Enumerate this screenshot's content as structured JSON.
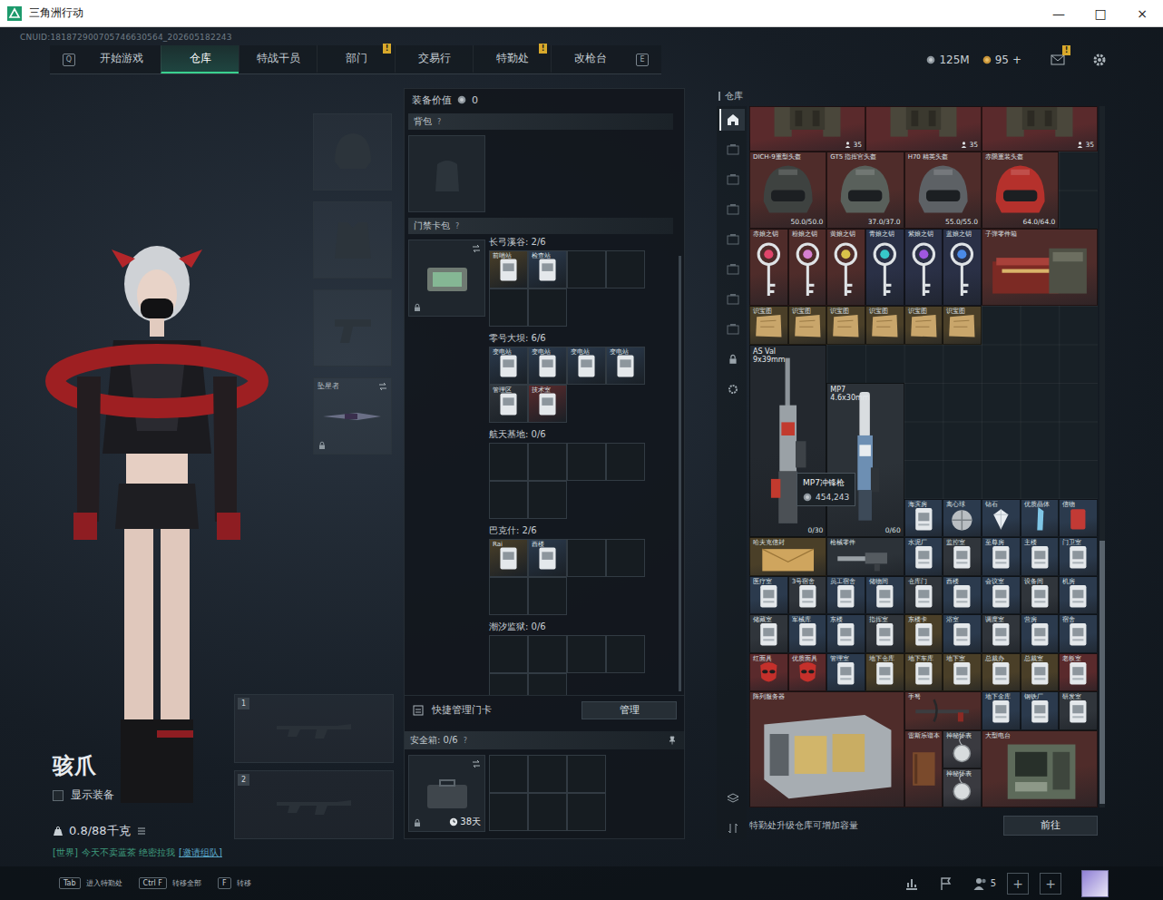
{
  "window": {
    "title": "三角洲行动",
    "controls": [
      "—",
      "□",
      "×"
    ]
  },
  "uid": "CNUID:181872900705746630564_202605182243",
  "nav": {
    "prev_key": "Q",
    "next_key": "E",
    "tabs": [
      {
        "label": "开始游戏",
        "selected": false
      },
      {
        "label": "仓库",
        "selected": true
      },
      {
        "label": "特战干员",
        "selected": false
      },
      {
        "label": "部门",
        "selected": false,
        "badge": "!"
      },
      {
        "label": "交易行",
        "selected": false
      },
      {
        "label": "特勤处",
        "selected": false,
        "badge": "!"
      },
      {
        "label": "改枪台",
        "selected": false
      }
    ],
    "currency": [
      {
        "kind": "coin",
        "value": "125M"
      },
      {
        "kind": "gold",
        "value": "95"
      }
    ],
    "add": "+",
    "mail_badge": "!"
  },
  "equipment_slots": [
    {
      "kind": "helmet",
      "locked": false
    },
    {
      "kind": "armor",
      "locked": false
    },
    {
      "kind": "pistol",
      "locked": false
    },
    {
      "kind": "melee",
      "label": "坠星者",
      "locked": true
    }
  ],
  "weapon_slots": [
    {
      "label": "1"
    },
    {
      "label": "2"
    }
  ],
  "character": {
    "name": "骇爪",
    "show_equipment": {
      "label": "显示装备",
      "checked": false
    },
    "weight": "0.8/88千克"
  },
  "chat": {
    "channel": "[世界]",
    "text": "今天不卖蓝茶 绝密拉我",
    "link": "[邀请组队]"
  },
  "loadout": {
    "value_label": "装备价值",
    "value": "0",
    "backpack": {
      "label": "背包",
      "help": "?"
    },
    "keycard_bag": {
      "label": "门禁卡包",
      "help": "?",
      "locked": true
    },
    "maps": [
      {
        "title": "长弓溪谷: 2/6",
        "cards": [
          {
            "name": "前哨站",
            "color": "#4a3f28"
          },
          {
            "name": "检查站",
            "color": "#2b3a4d"
          }
        ]
      },
      {
        "title": "零号大坝: 6/6",
        "cards": [
          {
            "name": "变电站",
            "color": "#2b3a4d"
          },
          {
            "name": "变电站",
            "color": "#2b3a4d"
          },
          {
            "name": "变电站",
            "color": "#2b3a4d"
          },
          {
            "name": "变电站",
            "color": "#2b3a4d"
          },
          {
            "name": "管理区",
            "color": "#30353b"
          },
          {
            "name": "技术室",
            "color": "#5a2a2c"
          }
        ]
      },
      {
        "title": "航天基地: 0/6",
        "cards": []
      },
      {
        "title": "巴克什: 2/6",
        "cards": [
          {
            "name": "Rai",
            "color": "#4a3f28"
          },
          {
            "name": "西楼",
            "color": "#2b3a4d"
          }
        ]
      },
      {
        "title": "潮汐监狱: 0/6",
        "cards": []
      }
    ],
    "quick_manage": {
      "label": "快捷管理门卡",
      "button": "管理"
    },
    "safe_box": {
      "label": "安全箱: 0/6",
      "help": "?",
      "days": "38天",
      "locked": true
    }
  },
  "warehouse": {
    "title": "仓库",
    "side_tabs": [
      {
        "kind": "home",
        "selected": true
      },
      {
        "kind": "box",
        "selected": false
      },
      {
        "kind": "box",
        "selected": false
      },
      {
        "kind": "box",
        "selected": false
      },
      {
        "kind": "box",
        "selected": false
      },
      {
        "kind": "box",
        "selected": false
      },
      {
        "kind": "box",
        "selected": false
      },
      {
        "kind": "box",
        "selected": false
      },
      {
        "kind": "lock",
        "selected": false
      },
      {
        "kind": "gear",
        "selected": false
      },
      {
        "kind": "layers",
        "selected": false
      },
      {
        "kind": "sort",
        "selected": false
      }
    ],
    "items": [
      {
        "kind": "armor",
        "badge": "35",
        "color": "#5a2a2c"
      },
      {
        "kind": "armor",
        "badge": "35",
        "color": "#5a2a2c"
      },
      {
        "kind": "armor",
        "badge": "35",
        "color": "#5a2a2c"
      },
      {
        "kind": "helmet",
        "name": "DICH-9重型头盔",
        "stat": "50.0/50.0",
        "color": "#4f2c2a",
        "tint": "#3e4240"
      },
      {
        "kind": "helmet",
        "name": "GT5 指挥官头盔",
        "stat": "37.0/37.0",
        "color": "#4f2c2a",
        "tint": "#59605b"
      },
      {
        "kind": "helmet",
        "name": "H70 精英头盔",
        "stat": "55.0/55.0",
        "color": "#4f2c2a",
        "tint": "#5d6165"
      },
      {
        "kind": "helmet",
        "name": "赤陨重装头盔",
        "stat": "64.0/64.0",
        "color": "#4f2c2a",
        "tint": "#b5312c"
      },
      {
        "kind": "key",
        "name": "赤娘之钥",
        "color": "#4f2c2a",
        "gem_color": "#e0456a"
      },
      {
        "kind": "key",
        "name": "粉娘之钥",
        "color": "#4f2c2a",
        "gem_color": "#d67fd0"
      },
      {
        "kind": "key",
        "name": "黄娘之钥",
        "color": "#4f2c2a",
        "gem_color": "#d9c24a"
      },
      {
        "kind": "key",
        "name": "青娘之钥",
        "color": "#2a3046",
        "gem_color": "#37c7c9"
      },
      {
        "kind": "key",
        "name": "紫娘之钥",
        "color": "#2a3046",
        "gem_color": "#a057e0"
      },
      {
        "kind": "key",
        "name": "蓝娘之钥",
        "color": "#2a3046",
        "gem_color": "#4a8ae6"
      },
      {
        "kind": "crate",
        "name": "子弹零件箱",
        "color": "#4f2c2a"
      },
      {
        "kind": "map",
        "name": "识宝图",
        "color": "#4a3f28"
      },
      {
        "kind": "map",
        "name": "识宝图",
        "color": "#4a3f28"
      },
      {
        "kind": "map",
        "name": "识宝图",
        "color": "#4a3f28"
      },
      {
        "kind": "map",
        "name": "识宝图",
        "color": "#4a3f28"
      },
      {
        "kind": "map",
        "name": "识宝图",
        "color": "#4a3f28"
      },
      {
        "kind": "map",
        "name": "识宝图",
        "color": "#4a3f28"
      },
      {
        "kind": "rifle",
        "name": "AS Val",
        "caliber": "9x39mm",
        "stat": "0/30",
        "color": "#23282e"
      },
      {
        "kind": "smg",
        "name": "MP7",
        "caliber": "4.6x30mm",
        "stat": "0/60",
        "color": "#2c3238"
      },
      {
        "kind": "card",
        "name": "海滨房",
        "color": "#2b3a4d"
      },
      {
        "kind": "ball",
        "name": "离心球",
        "color": "#2b3a4d"
      },
      {
        "kind": "diamond",
        "name": "钻石",
        "color": "#2b3a4d"
      },
      {
        "kind": "crystal",
        "name": "优质晶体",
        "color": "#2b3a4d"
      },
      {
        "kind": "token",
        "name": "信物",
        "color": "#2b3a4d"
      },
      {
        "kind": "envelope",
        "name": "哈夫克信封",
        "color": "#4a3f28"
      },
      {
        "kind": "part",
        "name": "枪械零件",
        "color": "#2c3238"
      },
      {
        "kind": "card",
        "name": "水泥厂",
        "color": "#2b3a4d"
      },
      {
        "kind": "card",
        "name": "监控室",
        "color": "#30353b"
      },
      {
        "kind": "card",
        "name": "至尊房",
        "color": "#2b3a4d"
      },
      {
        "kind": "card",
        "name": "主楼",
        "color": "#2b3a4d"
      },
      {
        "kind": "card",
        "name": "门卫室",
        "color": "#2b3a4d"
      },
      {
        "kind": "card",
        "name": "医疗室",
        "color": "#2b3a4d"
      },
      {
        "kind": "card",
        "name": "3号宿舍",
        "color": "#30353b"
      },
      {
        "kind": "card",
        "name": "员工宿舍",
        "color": "#2b3a4d"
      },
      {
        "kind": "card",
        "name": "储物间",
        "color": "#2b3a4d"
      },
      {
        "kind": "card",
        "name": "仓库门",
        "color": "#30353b"
      },
      {
        "kind": "card",
        "name": "西楼",
        "color": "#2b3a4d"
      },
      {
        "kind": "card",
        "name": "会议室",
        "color": "#2b3a4d"
      },
      {
        "kind": "card",
        "name": "设备间",
        "color": "#30353b"
      },
      {
        "kind": "card",
        "name": "机房",
        "color": "#2b3a4d"
      },
      {
        "kind": "card",
        "name": "储藏室",
        "color": "#30353b"
      },
      {
        "kind": "card",
        "name": "军械库",
        "color": "#2b3a4d"
      },
      {
        "kind": "card",
        "name": "东楼",
        "color": "#2b3a4d"
      },
      {
        "kind": "card",
        "name": "指挥室",
        "color": "#30353b"
      },
      {
        "kind": "card",
        "name": "东楼卡",
        "color": "#4a3f28"
      },
      {
        "kind": "card",
        "name": "浴室",
        "color": "#2b3a4d"
      },
      {
        "kind": "card",
        "name": "调度室",
        "color": "#30353b"
      },
      {
        "kind": "card",
        "name": "营房",
        "color": "#2b3a4d"
      },
      {
        "kind": "card",
        "name": "宿舍",
        "color": "#2b3a4d"
      },
      {
        "kind": "mask",
        "name": "红面具",
        "color": "#5a2a2c"
      },
      {
        "kind": "mask",
        "name": "优质面具",
        "color": "#5a2a2c"
      },
      {
        "kind": "card",
        "name": "管理室",
        "color": "#2b3a4d"
      },
      {
        "kind": "card",
        "name": "地下仓库",
        "color": "#4a3f28"
      },
      {
        "kind": "card",
        "name": "地下车库",
        "color": "#4a3f28"
      },
      {
        "kind": "card",
        "name": "地下室",
        "color": "#4a3f28"
      },
      {
        "kind": "card",
        "name": "总裁办",
        "color": "#4a3f28"
      },
      {
        "kind": "card",
        "name": "总裁室",
        "color": "#4a3f28"
      },
      {
        "kind": "card",
        "name": "老板室",
        "color": "#5a2a2c"
      },
      {
        "kind": "server",
        "name": "阵列服务器",
        "color": "#4f2c2a"
      },
      {
        "kind": "crossbow",
        "name": "手弩",
        "color": "#4f2c2a"
      },
      {
        "kind": "card",
        "name": "地下金库",
        "color": "#2b3a4d"
      },
      {
        "kind": "card",
        "name": "钢铁厂",
        "color": "#2b3a4d"
      },
      {
        "kind": "card",
        "name": "研发室",
        "color": "#30353b"
      },
      {
        "kind": "book",
        "name": "雷斯乐谱本",
        "color": "#4f2c2a"
      },
      {
        "kind": "watch",
        "name": "神秘怀表",
        "color": "#3a3a40"
      },
      {
        "kind": "radio",
        "name": "大型电台",
        "color": "#4f2c2a"
      },
      {
        "kind": "watch",
        "name": "神秘怀表",
        "color": "#3a3a40"
      }
    ],
    "tooltip": {
      "name": "MP7冲锋枪",
      "price": "454,243"
    },
    "footer": {
      "text": "特勤处升级仓库可增加容量",
      "button": "前往"
    }
  },
  "hints": [
    {
      "key": "Tab",
      "label": "进入特勤处"
    },
    {
      "key": "Ctrl F",
      "label": "转移全部"
    },
    {
      "key": "F",
      "label": "转移"
    }
  ],
  "bottom_bar": {
    "friends": "5",
    "add_buttons": [
      "+",
      "+"
    ]
  }
}
